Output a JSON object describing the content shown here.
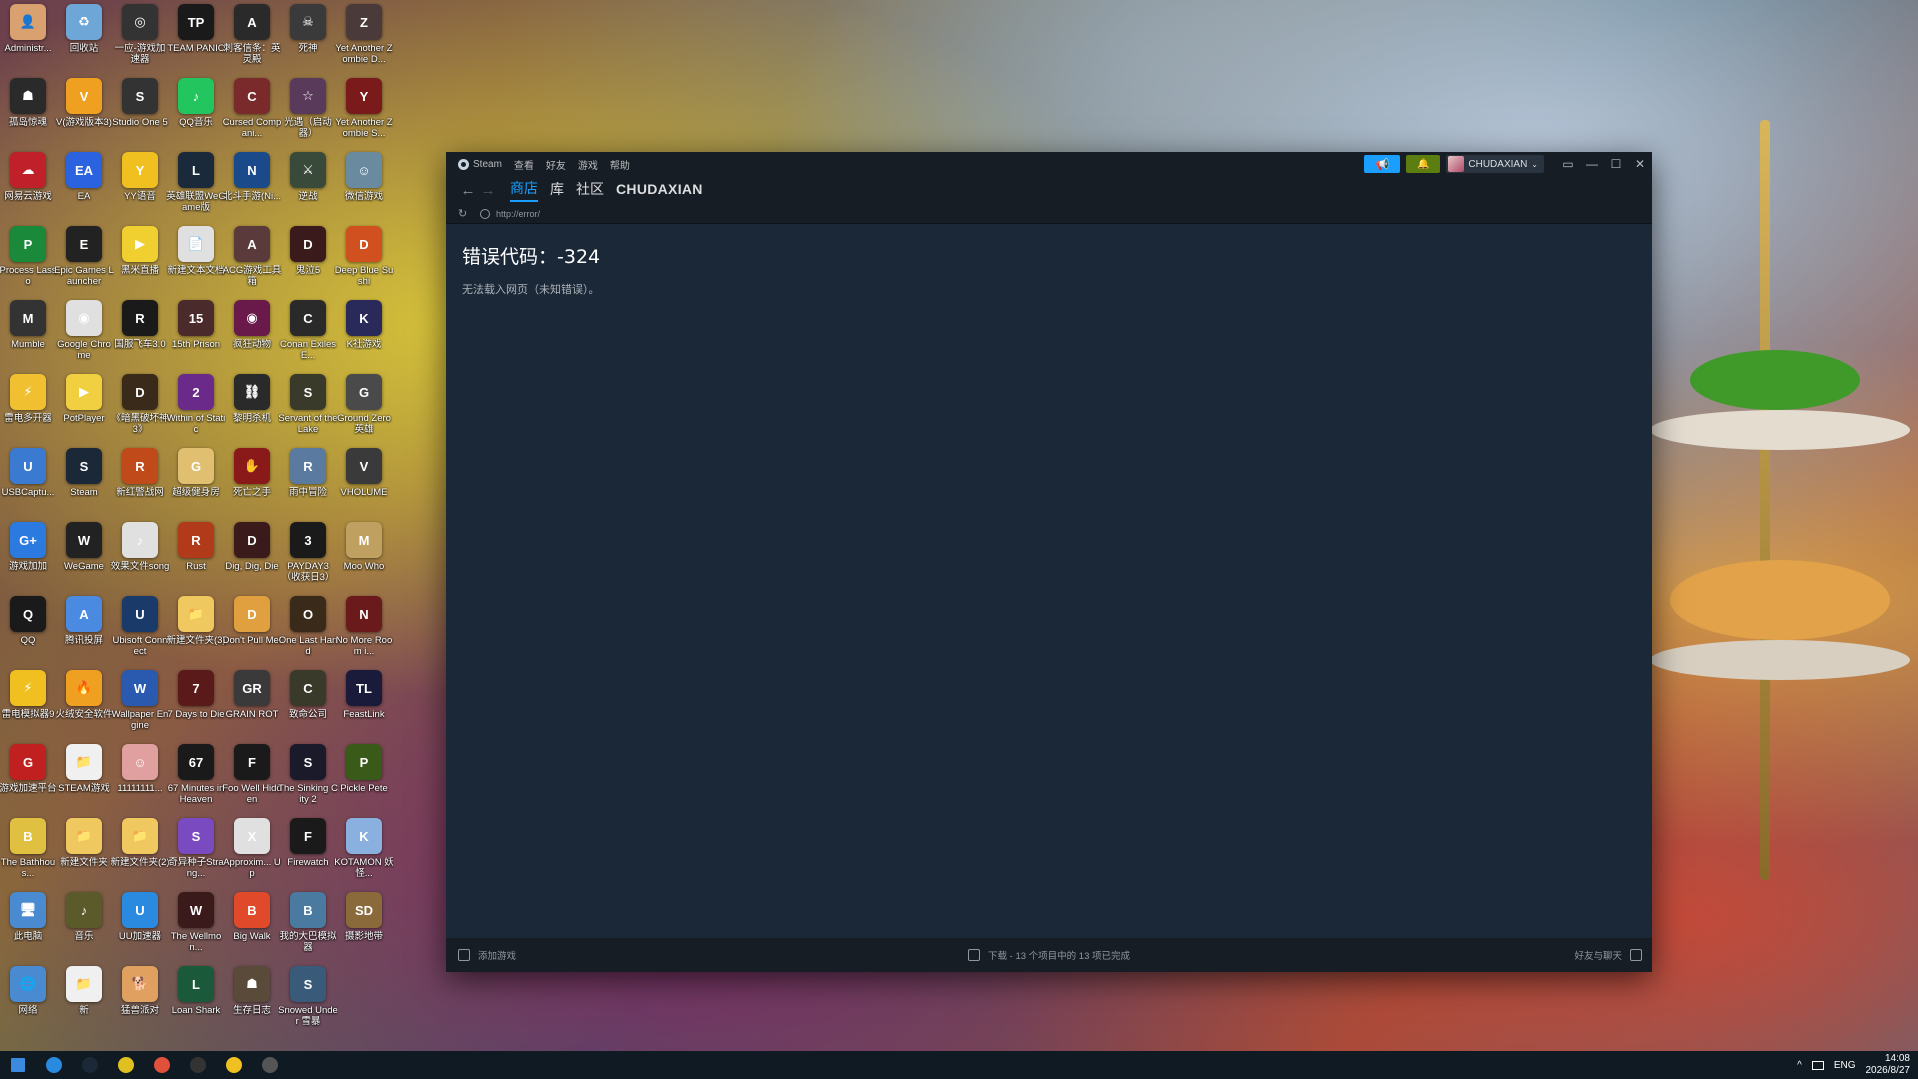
{
  "desktop": {
    "icons": [
      {
        "label": "Administr...",
        "color": "#d9a070",
        "glyph": "👤"
      },
      {
        "label": "回收站",
        "color": "#6fa6d8",
        "glyph": "♻"
      },
      {
        "label": "一应-游戏加速器",
        "color": "#333333",
        "glyph": "◎"
      },
      {
        "label": "TEAM PANIC",
        "color": "#1a1a1a",
        "glyph": "TP"
      },
      {
        "label": "刺客信条：英灵殿",
        "color": "#2a2a2a",
        "glyph": "A"
      },
      {
        "label": "死神",
        "color": "#3a3a3a",
        "glyph": "☠"
      },
      {
        "label": "Yet Another Zombie D...",
        "color": "#4a3a3a",
        "glyph": "Z"
      },
      {
        "label": "孤岛惊魂",
        "color": "#2a2a2a",
        "glyph": "☗"
      },
      {
        "label": "V(游戏版本3)",
        "color": "#f0a020",
        "glyph": "V"
      },
      {
        "label": "Studio One 5",
        "color": "#333333",
        "glyph": "S"
      },
      {
        "label": "QQ音乐",
        "color": "#22c55e",
        "glyph": "♪"
      },
      {
        "label": "Cursed Compani...",
        "color": "#7a2a2a",
        "glyph": "C"
      },
      {
        "label": "光遇（启动器）",
        "color": "#5a3a5a",
        "glyph": "☆"
      },
      {
        "label": "Yet Another Zombie S...",
        "color": "#7a1a1a",
        "glyph": "Y"
      },
      {
        "label": "网易云游戏",
        "color": "#c0202a",
        "glyph": "☁"
      },
      {
        "label": "EA",
        "color": "#2a62e0",
        "glyph": "EA"
      },
      {
        "label": "YY语音",
        "color": "#f0c020",
        "glyph": "Y"
      },
      {
        "label": "英雄联盟WeGame版",
        "color": "#1a2a3a",
        "glyph": "L"
      },
      {
        "label": "北斗手游(Ni...",
        "color": "#1a4a8a",
        "glyph": "N"
      },
      {
        "label": "逆战",
        "color": "#3a4a3a",
        "glyph": "⚔"
      },
      {
        "label": "微信游戏",
        "color": "#6a8aa0",
        "glyph": "☺"
      },
      {
        "label": "Process Lasso",
        "color": "#1a8a3a",
        "glyph": "P"
      },
      {
        "label": "Epic Games Launcher",
        "color": "#222222",
        "glyph": "E"
      },
      {
        "label": "黑米直播",
        "color": "#f0d030",
        "glyph": "▶"
      },
      {
        "label": "新建文本文档",
        "color": "#e0e0e0",
        "glyph": "📄"
      },
      {
        "label": "ACG游戏工具箱",
        "color": "#5a3a3a",
        "glyph": "A"
      },
      {
        "label": "鬼泣5",
        "color": "#3a1a1a",
        "glyph": "D"
      },
      {
        "label": "Deep Blue Sushi",
        "color": "#d05020",
        "glyph": "D"
      },
      {
        "label": "Mumble",
        "color": "#333333",
        "glyph": "M"
      },
      {
        "label": "Google Chrome",
        "color": "#e0e0e0",
        "glyph": "◉"
      },
      {
        "label": "国服飞车3.0",
        "color": "#1a1a1a",
        "glyph": "R"
      },
      {
        "label": "15th Prison",
        "color": "#4a2a2a",
        "glyph": "15"
      },
      {
        "label": "疯狂动物",
        "color": "#6a1a4a",
        "glyph": "◉"
      },
      {
        "label": "Conan Exiles E...",
        "color": "#2a2a2a",
        "glyph": "C"
      },
      {
        "label": "K社游戏",
        "color": "#2a2a5a",
        "glyph": "K"
      },
      {
        "label": "雷电多开器",
        "color": "#f0c030",
        "glyph": "⚡"
      },
      {
        "label": "PotPlayer",
        "color": "#f0d040",
        "glyph": "▶"
      },
      {
        "label": "《暗黑破坏神3》",
        "color": "#3a2a1a",
        "glyph": "D"
      },
      {
        "label": "Within of Static",
        "color": "#6a2a8a",
        "glyph": "2"
      },
      {
        "label": "黎明杀机",
        "color": "#2a2a2a",
        "glyph": "⛓"
      },
      {
        "label": "Servant of the Lake",
        "color": "#3a3a2a",
        "glyph": "S"
      },
      {
        "label": "Ground Zero 英雄",
        "color": "#4a4a4a",
        "glyph": "G"
      },
      {
        "label": "USBCaptu...",
        "color": "#3a7ad0",
        "glyph": "U"
      },
      {
        "label": "Steam",
        "color": "#1b2838",
        "glyph": "S"
      },
      {
        "label": "新红警战网",
        "color": "#c04a1a",
        "glyph": "R"
      },
      {
        "label": "超级健身房",
        "color": "#e0c070",
        "glyph": "G"
      },
      {
        "label": "死亡之手",
        "color": "#8a1a1a",
        "glyph": "✋"
      },
      {
        "label": "雨中冒险",
        "color": "#5a7aa0",
        "glyph": "R"
      },
      {
        "label": "VHOLUME",
        "color": "#3a3a3a",
        "glyph": "V"
      },
      {
        "label": "游戏加加",
        "color": "#2a7ae0",
        "glyph": "G+"
      },
      {
        "label": "WeGame",
        "color": "#222222",
        "glyph": "W"
      },
      {
        "label": "效果文件song",
        "color": "#e0e0e0",
        "glyph": "♪"
      },
      {
        "label": "Rust",
        "color": "#b03a1a",
        "glyph": "R"
      },
      {
        "label": "Dig, Dig, Die",
        "color": "#3a1a1a",
        "glyph": "D"
      },
      {
        "label": "PAYDAY3（收获日3）",
        "color": "#1a1a1a",
        "glyph": "3"
      },
      {
        "label": "Moo Who",
        "color": "#c0a060",
        "glyph": "M"
      },
      {
        "label": "QQ",
        "color": "#1a1a1a",
        "glyph": "Q"
      },
      {
        "label": "腾讯投屏",
        "color": "#4a8ae0",
        "glyph": "A"
      },
      {
        "label": "Ubisoft Connect",
        "color": "#1a3a6a",
        "glyph": "U"
      },
      {
        "label": "新建文件夹(3)",
        "color": "#f0c860",
        "glyph": "📁"
      },
      {
        "label": "Don't Pull Me!",
        "color": "#e0a040",
        "glyph": "D"
      },
      {
        "label": "One Last Hand",
        "color": "#3a2a1a",
        "glyph": "O"
      },
      {
        "label": "No More Room i...",
        "color": "#6a1a1a",
        "glyph": "N"
      },
      {
        "label": "雷电模拟器9",
        "color": "#f0c020",
        "glyph": "⚡"
      },
      {
        "label": "火绒安全软件",
        "color": "#f0a020",
        "glyph": "🔥"
      },
      {
        "label": "Wallpaper Engine",
        "color": "#2a5ab0",
        "glyph": "W"
      },
      {
        "label": "7 Days to Die",
        "color": "#5a1a1a",
        "glyph": "7"
      },
      {
        "label": "GRAIN ROT",
        "color": "#3a3a3a",
        "glyph": "GR"
      },
      {
        "label": "致命公司",
        "color": "#3a3a2a",
        "glyph": "C"
      },
      {
        "label": "FeastLink",
        "color": "#1a1a3a",
        "glyph": "TL"
      },
      {
        "label": "游戏加速平台",
        "color": "#c02020",
        "glyph": "G"
      },
      {
        "label": "STEAM游戏",
        "color": "#f0f0f0",
        "glyph": "📁"
      },
      {
        "label": "11111111...",
        "color": "#e0a0a0",
        "glyph": "☺"
      },
      {
        "label": "67 Minutes in Heaven",
        "color": "#1a1a1a",
        "glyph": "67"
      },
      {
        "label": "Foo Well Hidden",
        "color": "#1a1a1a",
        "glyph": "F"
      },
      {
        "label": "The Sinking City 2",
        "color": "#1a1a2a",
        "glyph": "S"
      },
      {
        "label": "Pickle Pete",
        "color": "#3a5a1a",
        "glyph": "P"
      },
      {
        "label": "The Bathhous...",
        "color": "#e0c040",
        "glyph": "B"
      },
      {
        "label": "新建文件夹",
        "color": "#f0c860",
        "glyph": "📁"
      },
      {
        "label": "新建文件夹(2)",
        "color": "#f0c860",
        "glyph": "📁"
      },
      {
        "label": "奇异种子Strang...",
        "color": "#7a4ac0",
        "glyph": "S"
      },
      {
        "label": "Approxim... Up",
        "color": "#e0e0e0",
        "glyph": "X"
      },
      {
        "label": "Firewatch",
        "color": "#1a1a1a",
        "glyph": "F"
      },
      {
        "label": "KOTAMON 妖怪...",
        "color": "#8ab0e0",
        "glyph": "K"
      },
      {
        "label": "此电脑",
        "color": "#4a8ad0",
        "glyph": "🖥"
      },
      {
        "label": "音乐",
        "color": "#5a5a2a",
        "glyph": "♪"
      },
      {
        "label": "UU加速器",
        "color": "#2a8ae0",
        "glyph": "U"
      },
      {
        "label": "The Wellmon...",
        "color": "#3a1a1a",
        "glyph": "W"
      },
      {
        "label": "Big Walk",
        "color": "#e04a2a",
        "glyph": "B"
      },
      {
        "label": "我的大巴模拟器",
        "color": "#4a7aa0",
        "glyph": "B"
      },
      {
        "label": "摄影地带",
        "color": "#8a6a3a",
        "glyph": "SD"
      },
      {
        "label": "网络",
        "color": "#4a8ad0",
        "glyph": "🌐"
      },
      {
        "label": "新",
        "color": "#f0f0f0",
        "glyph": "📁"
      },
      {
        "label": "猛兽派对",
        "color": "#e0a060",
        "glyph": "🐕"
      },
      {
        "label": "Loan Shark",
        "color": "#1a5a3a",
        "glyph": "L"
      },
      {
        "label": "生存日志",
        "color": "#5a4a3a",
        "glyph": "☗"
      },
      {
        "label": "Snowed Under 雪暴",
        "color": "#3a5a7a",
        "glyph": "S"
      }
    ]
  },
  "steam": {
    "menu": {
      "steam": "Steam",
      "view": "查看",
      "friends": "好友",
      "games": "游戏",
      "help": "帮助"
    },
    "account": {
      "name": "CHUDAXIAN",
      "caret": "⌄"
    },
    "buttons": {
      "broadcast_icon": "📢",
      "notify_icon": "🔔"
    },
    "window_controls": {
      "screen": "▭",
      "minimize": "—",
      "maximize": "☐",
      "close": "✕"
    },
    "nav": {
      "back": "←",
      "forward": "→",
      "tabs": [
        "商店",
        "库",
        "社区",
        "CHUDAXIAN"
      ]
    },
    "url": {
      "reload": "↻",
      "text": "http://error/"
    },
    "content": {
      "error_title": "错误代码：-324",
      "error_desc": "无法载入网页（未知错误）。"
    },
    "bottom": {
      "add_game": "添加游戏",
      "downloads": "下载 - 13 个项目中的 13 项已完成",
      "friends_chat": "好友与聊天"
    }
  },
  "taskbar": {
    "apps": [
      {
        "name": "start",
        "color": "#3a8ae0"
      },
      {
        "name": "uu",
        "color": "#2a8ae0"
      },
      {
        "name": "steam",
        "color": "#1b2838"
      },
      {
        "name": "qq-music",
        "color": "#e0c020"
      },
      {
        "name": "chrome",
        "color": "#e0503a"
      },
      {
        "name": "accelerator",
        "color": "#333333"
      },
      {
        "name": "yy",
        "color": "#f0c020"
      },
      {
        "name": "studio",
        "color": "#555555"
      }
    ],
    "tray": {
      "chevron": "^",
      "lang": "ENG",
      "time": "14:08",
      "date": "2026/8/27"
    }
  }
}
